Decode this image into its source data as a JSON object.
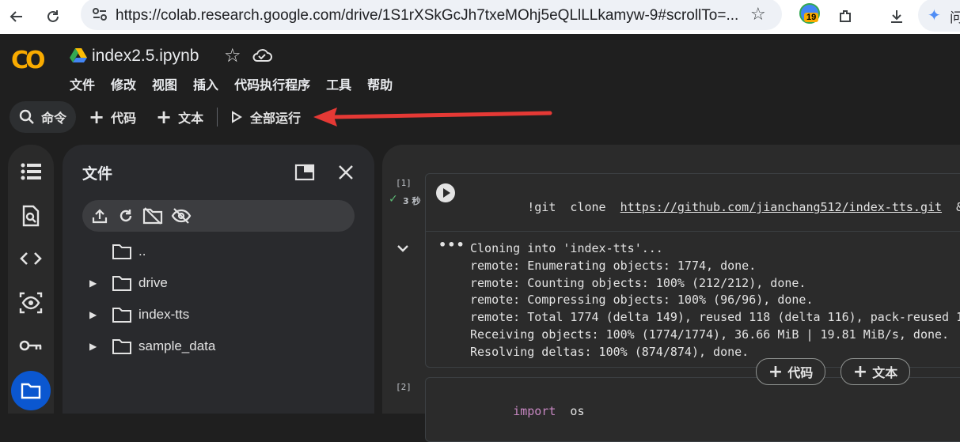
{
  "browser": {
    "url": "https://colab.research.google.com/drive/1S1rXSkGcJh7txeMOhj5eQLlLLkamyw-9#scrollTo=...",
    "extension_badge": "19",
    "gemini_label": "问"
  },
  "colab": {
    "logo": "CO",
    "filename": "index2.5.ipynb",
    "menu": [
      "文件",
      "修改",
      "视图",
      "插入",
      "代码执行程序",
      "工具",
      "帮助"
    ]
  },
  "toolbar": {
    "command_label": "命令",
    "add_code_label": "代码",
    "add_text_label": "文本",
    "run_all_label": "全部运行"
  },
  "files_panel": {
    "title": "文件",
    "items": [
      {
        "name": "..",
        "expandable": false
      },
      {
        "name": "drive",
        "expandable": true
      },
      {
        "name": "index-tts",
        "expandable": true
      },
      {
        "name": "sample_data",
        "expandable": true
      }
    ]
  },
  "cells": [
    {
      "exec_count": "[1]",
      "duration": "3 秒",
      "code_prefix": "!git  clone  ",
      "code_link": "https://github.com/jianchang512/index-tts.git",
      "code_suffix": "  &&  cd  i",
      "output": [
        "Cloning into 'index-tts'...",
        "remote: Enumerating objects: 1774, done.",
        "remote: Counting objects: 100% (212/212), done.",
        "remote: Compressing objects: 100% (96/96), done.",
        "remote: Total 1774 (delta 149), reused 118 (delta 116), pack-reused 1",
        "Receiving objects: 100% (1774/1774), 36.66 MiB | 19.81 MiB/s, done.",
        "Resolving deltas: 100% (874/874), done."
      ]
    },
    {
      "exec_count": "[2]",
      "code_keyword": "import",
      "code_rest": "  os"
    }
  ],
  "add_bar": {
    "code_label": "代码",
    "text_label": "文本"
  },
  "colors": {
    "accent_orange": "#f9ab00",
    "arrow_red": "#e53935",
    "success_green": "#5bb974"
  }
}
